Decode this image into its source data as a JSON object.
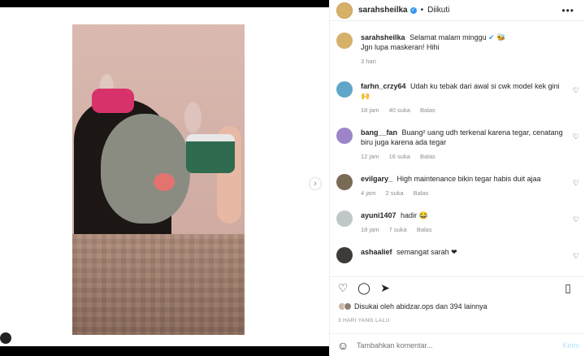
{
  "post": {
    "username": "sarahsheilka",
    "follow_status": "Diikuti",
    "caption_line1": "Selamat malam minggu",
    "caption_line2": "Jgn lupa maskeran! Hihi",
    "caption_time": "3 hari",
    "next_icon": "chevron-right-icon"
  },
  "comments": [
    {
      "user": "farhn_crzy64",
      "text": "Udah ku tebak dari awal si cwk model kek gini 🙌",
      "time": "18 jam",
      "likes": "40 suka",
      "reply": "Balas",
      "avatar_color": "#5fa6c8"
    },
    {
      "user": "bang__fan",
      "text": "Buang² uang udh terkenal karena tegar, cenatang biru juga karena ada tegar",
      "time": "12 jam",
      "likes": "16 suka",
      "reply": "Balas",
      "avatar_color": "#9c84c9"
    },
    {
      "user": "evilgary_",
      "text": "High maintenance bikin tegar habis duit ajaa",
      "time": "4 jam",
      "likes": "2 suka",
      "reply": "Balas",
      "avatar_color": "#7a6b57"
    },
    {
      "user": "ayuni1407",
      "text": "hadir 😂",
      "time": "18 jam",
      "likes": "7 suka",
      "reply": "Balas",
      "avatar_color": "#c0c7c9"
    },
    {
      "user": "ashaalief",
      "text": "semangat sarah ❤",
      "time": "",
      "likes": "",
      "reply": "",
      "avatar_color": "#3f3a3a"
    }
  ],
  "likes": {
    "text": "Disukai oleh abidzar.ops dan 394 lainnya"
  },
  "timeago": "3 HARI YANG LALU",
  "compose": {
    "placeholder": "Tambahkan komentar...",
    "send": "Kirim"
  },
  "colors": {
    "accent": "#3897f0",
    "muted": "#8e8e8e",
    "text": "#262626"
  }
}
